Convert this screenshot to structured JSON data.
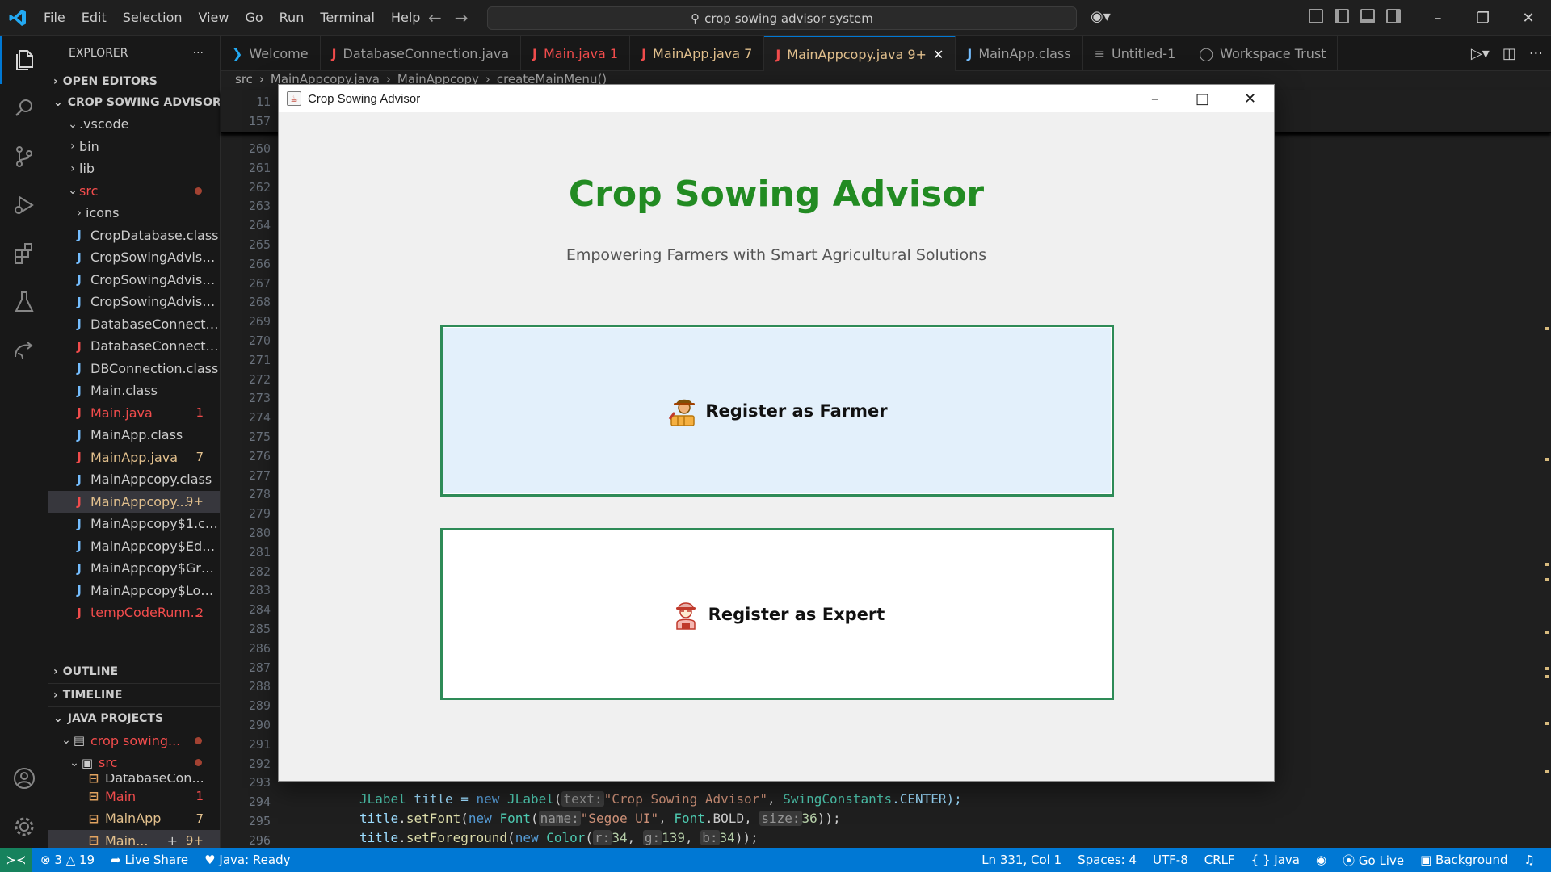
{
  "menu": [
    "File",
    "Edit",
    "Selection",
    "View",
    "Go",
    "Run",
    "Terminal",
    "Help"
  ],
  "search": {
    "text": "crop sowing advisor system"
  },
  "sidebar": {
    "title": "EXPLORER",
    "open_editors": "OPEN EDITORS",
    "project": "CROP SOWING ADVISOR S...",
    "items": [
      {
        "label": ".vscode"
      },
      {
        "label": "bin"
      },
      {
        "label": "lib"
      },
      {
        "label": "src"
      },
      {
        "label": "icons"
      },
      {
        "label": "CropDatabase.class"
      },
      {
        "label": "CropSowingAdvisor...."
      },
      {
        "label": "CropSowingAdvisor..."
      },
      {
        "label": "CropSowingAdvisor..."
      },
      {
        "label": "DatabaseConnectio..."
      },
      {
        "label": "DatabaseConnectio..."
      },
      {
        "label": "DBConnection.class"
      },
      {
        "label": "Main.class"
      },
      {
        "label": "Main.java",
        "badge": "1"
      },
      {
        "label": "MainApp.class"
      },
      {
        "label": "MainApp.java",
        "badge": "7"
      },
      {
        "label": "MainAppcopy.class"
      },
      {
        "label": "MainAppcopy....",
        "badge": "9+"
      },
      {
        "label": "MainAppcopy$1.class"
      },
      {
        "label": "MainAppcopy$Edge..."
      },
      {
        "label": "MainAppcopy$Grap..."
      },
      {
        "label": "MainAppcopy$Locat..."
      },
      {
        "label": "tempCodeRunn...",
        "badge": "2"
      }
    ],
    "outline": "OUTLINE",
    "timeline": "TIMELINE",
    "java_projects": "JAVA PROJECTS",
    "jp_items": [
      {
        "label": "crop sowing..."
      },
      {
        "label": "src"
      },
      {
        "label": "DatabaseCon..."
      },
      {
        "label": "Main",
        "badge": "1"
      },
      {
        "label": "MainApp",
        "badge": "7"
      },
      {
        "label": "Main...",
        "badge": "9+"
      }
    ]
  },
  "tabs": [
    {
      "label": "Welcome"
    },
    {
      "label": "DatabaseConnection.java"
    },
    {
      "label": "Main.java 1"
    },
    {
      "label": "MainApp.java 7"
    },
    {
      "label": "MainAppcopy.java 9+"
    },
    {
      "label": "MainApp.class"
    },
    {
      "label": "Untitled-1"
    },
    {
      "label": "Workspace Trust"
    }
  ],
  "breadcrumb": [
    "src",
    "MainAppcopy.java",
    "MainAppcopy",
    "createMainMenu()"
  ],
  "editor": {
    "sticky_lines": [
      "11",
      "157"
    ],
    "line_numbers": [
      "260",
      "261",
      "262",
      "263",
      "264",
      "265",
      "266",
      "267",
      "268",
      "269",
      "270",
      "271",
      "272",
      "273",
      "274",
      "275",
      "276",
      "277",
      "278",
      "279",
      "280",
      "281",
      "282",
      "283",
      "284",
      "285",
      "286",
      "287",
      "288",
      "289",
      "290",
      "291",
      "292",
      "293",
      "294",
      "295",
      "296"
    ],
    "code_294": {
      "p1": "JLabel",
      "p2": " title = ",
      "p3": "new",
      "p4": " ",
      "p5": "JLabel",
      "p6": "(",
      "h1": "text:",
      "s1": "\"Crop Sowing Advisor\"",
      "p7": ", ",
      "p8": "SwingConstants",
      "p9": ".CENTER);"
    },
    "code_295": {
      "p1": "title",
      "p2": ".",
      "p3": "setFont",
      "p4": "(",
      "p5": "new",
      "p6": " ",
      "p7": "Font",
      "p8": "(",
      "h1": "name:",
      "s1": "\"Segoe UI\"",
      "p9": ", ",
      "p10": "Font",
      "p11": ".BOLD, ",
      "h2": "size:",
      "n1": "36",
      "p12": "));"
    },
    "code_296": {
      "p1": "title",
      "p2": ".",
      "p3": "setForeground",
      "p4": "(",
      "p5": "new",
      "p6": " ",
      "p7": "Color",
      "p8": "(",
      "h1": "r:",
      "n1": "34",
      "p9": ", ",
      "h2": "g:",
      "n2": "139",
      "p10": ", ",
      "h3": "b:",
      "n3": "34",
      "p11": "));"
    }
  },
  "status": {
    "errors": "3",
    "warnings": "19",
    "live_share": "Live Share",
    "java": "Java: Ready",
    "position": "Ln 331, Col 1",
    "spaces": "Spaces: 4",
    "encoding": "UTF-8",
    "eol": "CRLF",
    "language": "Java",
    "go_live": "Go Live",
    "background": "Background"
  },
  "app": {
    "window_title": "Crop Sowing Advisor",
    "heading": "Crop Sowing Advisor",
    "subtitle": "Empowering Farmers with Smart Agricultural Solutions",
    "farmer_button": "Register as Farmer",
    "expert_button": "Register as Expert",
    "heading_color": "#228B22"
  }
}
